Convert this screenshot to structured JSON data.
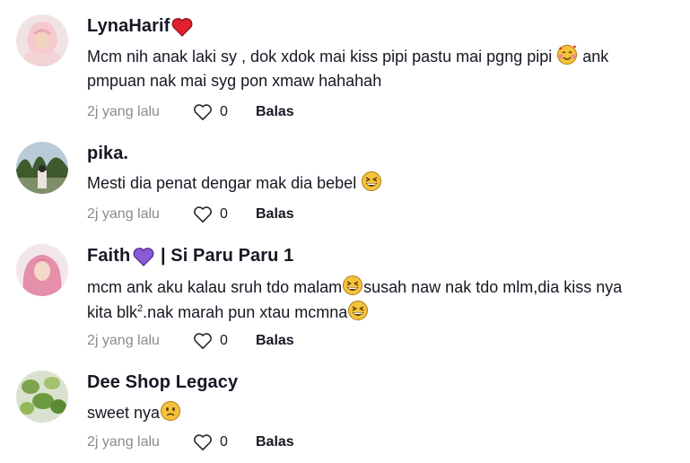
{
  "comments": [
    {
      "username": "LynaHarif",
      "text_1": "Mcm nih anak laki sy , dok xdok mai kiss pipi pastu mai pgng pipi ",
      "text_1b": " ank",
      "text_2": "pmpuan nak mai syg pon xmaw hahahah",
      "time": "2j yang lalu",
      "likes": "0",
      "reply": "Balas",
      "name_emoji": "red-heart-icon",
      "body_emoji": "smiling-face-with-hearts-icon"
    },
    {
      "username": "pika.",
      "text_1": "Mesti dia penat dengar mak dia bebel ",
      "time": "2j yang lalu",
      "likes": "0",
      "reply": "Balas",
      "body_emoji": "grinning-squinting-face-icon"
    },
    {
      "username_a": "Faith",
      "username_b": " | Si Paru Paru 1",
      "text_1a": "mcm ank aku kalau sruh tdo malam",
      "text_1b": "susah naw nak tdo mlm,dia kiss nya",
      "text_2a": "kita blk",
      "text_2sup": "2",
      "text_2b": ".nak marah pun xtau mcmna",
      "time": "2j yang lalu",
      "likes": "0",
      "reply": "Balas",
      "name_emoji": "purple-heart-icon",
      "body_emoji": "grinning-squinting-face-icon"
    },
    {
      "username": "Dee Shop Legacy",
      "text_1": "sweet nya",
      "time": "2j yang lalu",
      "likes": "0",
      "reply": "Balas",
      "body_emoji": "slightly-frowning-face-icon"
    }
  ],
  "colors": {
    "text": "#161823",
    "meta": "#8a8b91",
    "red_heart": "#e0202c",
    "purple_heart": "#8a5bd6",
    "emoji_yellow": "#f5c33b"
  }
}
